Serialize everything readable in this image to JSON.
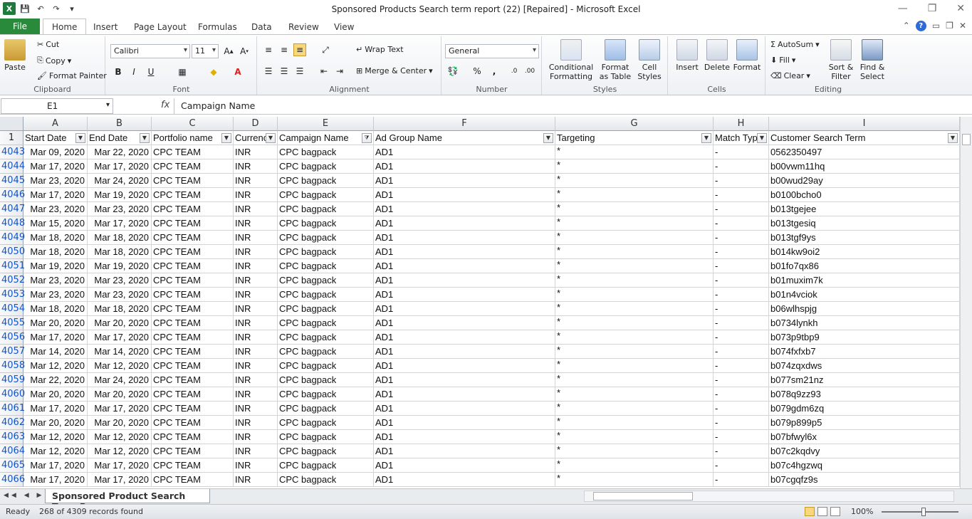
{
  "window": {
    "title": "Sponsored Products Search term report (22) [Repaired]  -  Microsoft Excel",
    "app_icon": "X"
  },
  "ribbon": {
    "file_tab": "File",
    "tabs": [
      "Home",
      "Insert",
      "Page Layout",
      "Formulas",
      "Data",
      "Review",
      "View"
    ],
    "active_tab": "Home",
    "clipboard": {
      "paste": "Paste",
      "cut": "Cut",
      "copy": "Copy",
      "format_painter": "Format Painter",
      "label": "Clipboard"
    },
    "font": {
      "name": "Calibri",
      "size": "11",
      "label": "Font",
      "bold": "B",
      "italic": "I",
      "underline": "U"
    },
    "alignment": {
      "wrap": "Wrap Text",
      "merge": "Merge & Center",
      "label": "Alignment"
    },
    "number": {
      "format": "General",
      "label": "Number",
      "percent": "%",
      "comma": ","
    },
    "styles": {
      "conditional": "Conditional Formatting",
      "format_table": "Format as Table",
      "cell_styles": "Cell Styles",
      "label": "Styles"
    },
    "cells": {
      "insert": "Insert",
      "delete": "Delete",
      "format": "Format",
      "label": "Cells"
    },
    "editing": {
      "autosum": "AutoSum",
      "fill": "Fill",
      "clear": "Clear",
      "sort": "Sort & Filter",
      "find": "Find & Select",
      "label": "Editing"
    }
  },
  "formula_bar": {
    "name_box": "E1",
    "fx": "fx",
    "formula": "Campaign Name"
  },
  "sheet": {
    "columns": [
      "A",
      "B",
      "C",
      "D",
      "E",
      "F",
      "G",
      "H",
      "I"
    ],
    "headers": [
      "Start Date",
      "End Date",
      "Portfolio name",
      "Currency",
      "Campaign Name",
      "Ad Group Name",
      "Targeting",
      "Match Type",
      "Customer Search Term"
    ],
    "rows": [
      {
        "n": "4043",
        "a": "Mar 09, 2020",
        "b": "Mar 22, 2020",
        "term": "0562350497"
      },
      {
        "n": "4044",
        "a": "Mar 17, 2020",
        "b": "Mar 17, 2020",
        "term": "b00vwm11hq"
      },
      {
        "n": "4045",
        "a": "Mar 23, 2020",
        "b": "Mar 24, 2020",
        "term": "b00wud29ay"
      },
      {
        "n": "4046",
        "a": "Mar 17, 2020",
        "b": "Mar 19, 2020",
        "term": "b0100bcho0"
      },
      {
        "n": "4047",
        "a": "Mar 23, 2020",
        "b": "Mar 23, 2020",
        "term": "b013tgejee"
      },
      {
        "n": "4048",
        "a": "Mar 15, 2020",
        "b": "Mar 17, 2020",
        "term": "b013tgesiq"
      },
      {
        "n": "4049",
        "a": "Mar 18, 2020",
        "b": "Mar 18, 2020",
        "term": "b013tgf9ys"
      },
      {
        "n": "4050",
        "a": "Mar 18, 2020",
        "b": "Mar 18, 2020",
        "term": "b014kw9oi2"
      },
      {
        "n": "4051",
        "a": "Mar 19, 2020",
        "b": "Mar 19, 2020",
        "term": "b01fo7qx86"
      },
      {
        "n": "4052",
        "a": "Mar 23, 2020",
        "b": "Mar 23, 2020",
        "term": "b01muxim7k"
      },
      {
        "n": "4053",
        "a": "Mar 23, 2020",
        "b": "Mar 23, 2020",
        "term": "b01n4vciok"
      },
      {
        "n": "4054",
        "a": "Mar 18, 2020",
        "b": "Mar 18, 2020",
        "term": "b06wlhspjg"
      },
      {
        "n": "4055",
        "a": "Mar 20, 2020",
        "b": "Mar 20, 2020",
        "term": "b0734lynkh"
      },
      {
        "n": "4056",
        "a": "Mar 17, 2020",
        "b": "Mar 17, 2020",
        "term": "b073p9tbp9"
      },
      {
        "n": "4057",
        "a": "Mar 14, 2020",
        "b": "Mar 14, 2020",
        "term": "b074fxfxb7"
      },
      {
        "n": "4058",
        "a": "Mar 12, 2020",
        "b": "Mar 12, 2020",
        "term": "b074zqxdws"
      },
      {
        "n": "4059",
        "a": "Mar 22, 2020",
        "b": "Mar 24, 2020",
        "term": "b077sm21nz"
      },
      {
        "n": "4060",
        "a": "Mar 20, 2020",
        "b": "Mar 20, 2020",
        "term": "b078q9zz93"
      },
      {
        "n": "4061",
        "a": "Mar 17, 2020",
        "b": "Mar 17, 2020",
        "term": "b079gdm6zq"
      },
      {
        "n": "4062",
        "a": "Mar 20, 2020",
        "b": "Mar 20, 2020",
        "term": "b079p899p5"
      },
      {
        "n": "4063",
        "a": "Mar 12, 2020",
        "b": "Mar 12, 2020",
        "term": "b07bfwyl6x"
      },
      {
        "n": "4064",
        "a": "Mar 12, 2020",
        "b": "Mar 12, 2020",
        "term": "b07c2kqdvy"
      },
      {
        "n": "4065",
        "a": "Mar 17, 2020",
        "b": "Mar 17, 2020",
        "term": "b07c4hgzwq"
      },
      {
        "n": "4066",
        "a": "Mar 17, 2020",
        "b": "Mar 17, 2020",
        "term": "b07cgqfz9s"
      }
    ],
    "portfolio": "CPC TEAM",
    "currency": "INR",
    "campaign": "CPC bagpack",
    "ad_group": "AD1",
    "targeting": "*",
    "match_type": "-"
  },
  "sheet_tab": "Sponsored Product Search Term R",
  "status": {
    "ready": "Ready",
    "records": "268 of 4309 records found",
    "zoom": "100%"
  }
}
